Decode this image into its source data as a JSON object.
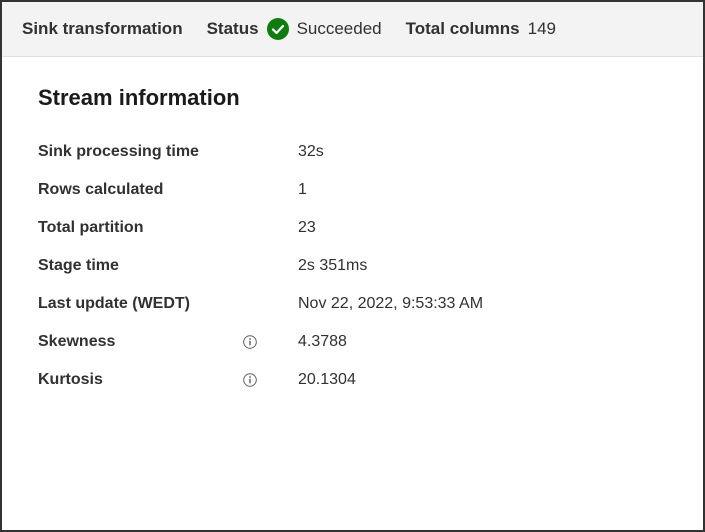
{
  "header": {
    "transformation_label": "Sink transformation",
    "status_label": "Status",
    "status_value": "Succeeded",
    "columns_label": "Total columns",
    "columns_value": "149"
  },
  "section": {
    "title": "Stream information",
    "rows": [
      {
        "label": "Sink processing time",
        "value": "32s",
        "has_info": false
      },
      {
        "label": "Rows calculated",
        "value": "1",
        "has_info": false
      },
      {
        "label": "Total partition",
        "value": "23",
        "has_info": false
      },
      {
        "label": "Stage time",
        "value": "2s 351ms",
        "has_info": false
      },
      {
        "label": "Last update (WEDT)",
        "value": "Nov 22, 2022, 9:53:33 AM",
        "has_info": false
      },
      {
        "label": "Skewness",
        "value": "4.3788",
        "has_info": true
      },
      {
        "label": "Kurtosis",
        "value": "20.1304",
        "has_info": true
      }
    ]
  },
  "colors": {
    "success": "#107c10",
    "info_icon": "#605e5c"
  }
}
